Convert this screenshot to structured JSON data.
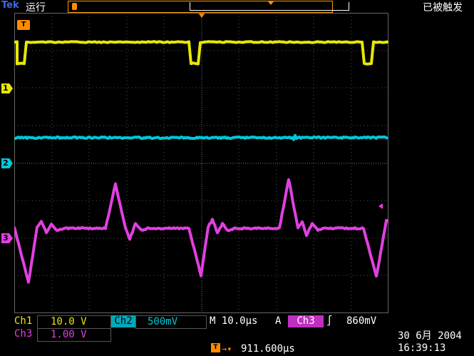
{
  "header": {
    "brand": "Tek",
    "run_state": "运行",
    "trigger_status": "已被触发"
  },
  "markers": {
    "trigger": "T",
    "ch1": "1",
    "ch2": "2",
    "ch3": "3"
  },
  "readouts": {
    "ch1_label": "Ch1",
    "ch1_scale": "10.0 V",
    "ch2_label": "Ch2",
    "ch2_scale": "500mV",
    "timebase": "M 10.0µs",
    "trigger_mode": "A",
    "trigger_source": "Ch3",
    "trigger_slope": "∫",
    "trigger_level": "860mV",
    "ch3_label": "Ch3",
    "ch3_scale": "1.00 V",
    "date": "30 6月  2004",
    "time": "16:39:13",
    "position_icon": "T",
    "position_value": "911.600µs"
  },
  "colors": {
    "ch1": "#e8e800",
    "ch2": "#00c8d8",
    "ch3": "#e040e0",
    "trigger": "#ff8c00"
  }
}
